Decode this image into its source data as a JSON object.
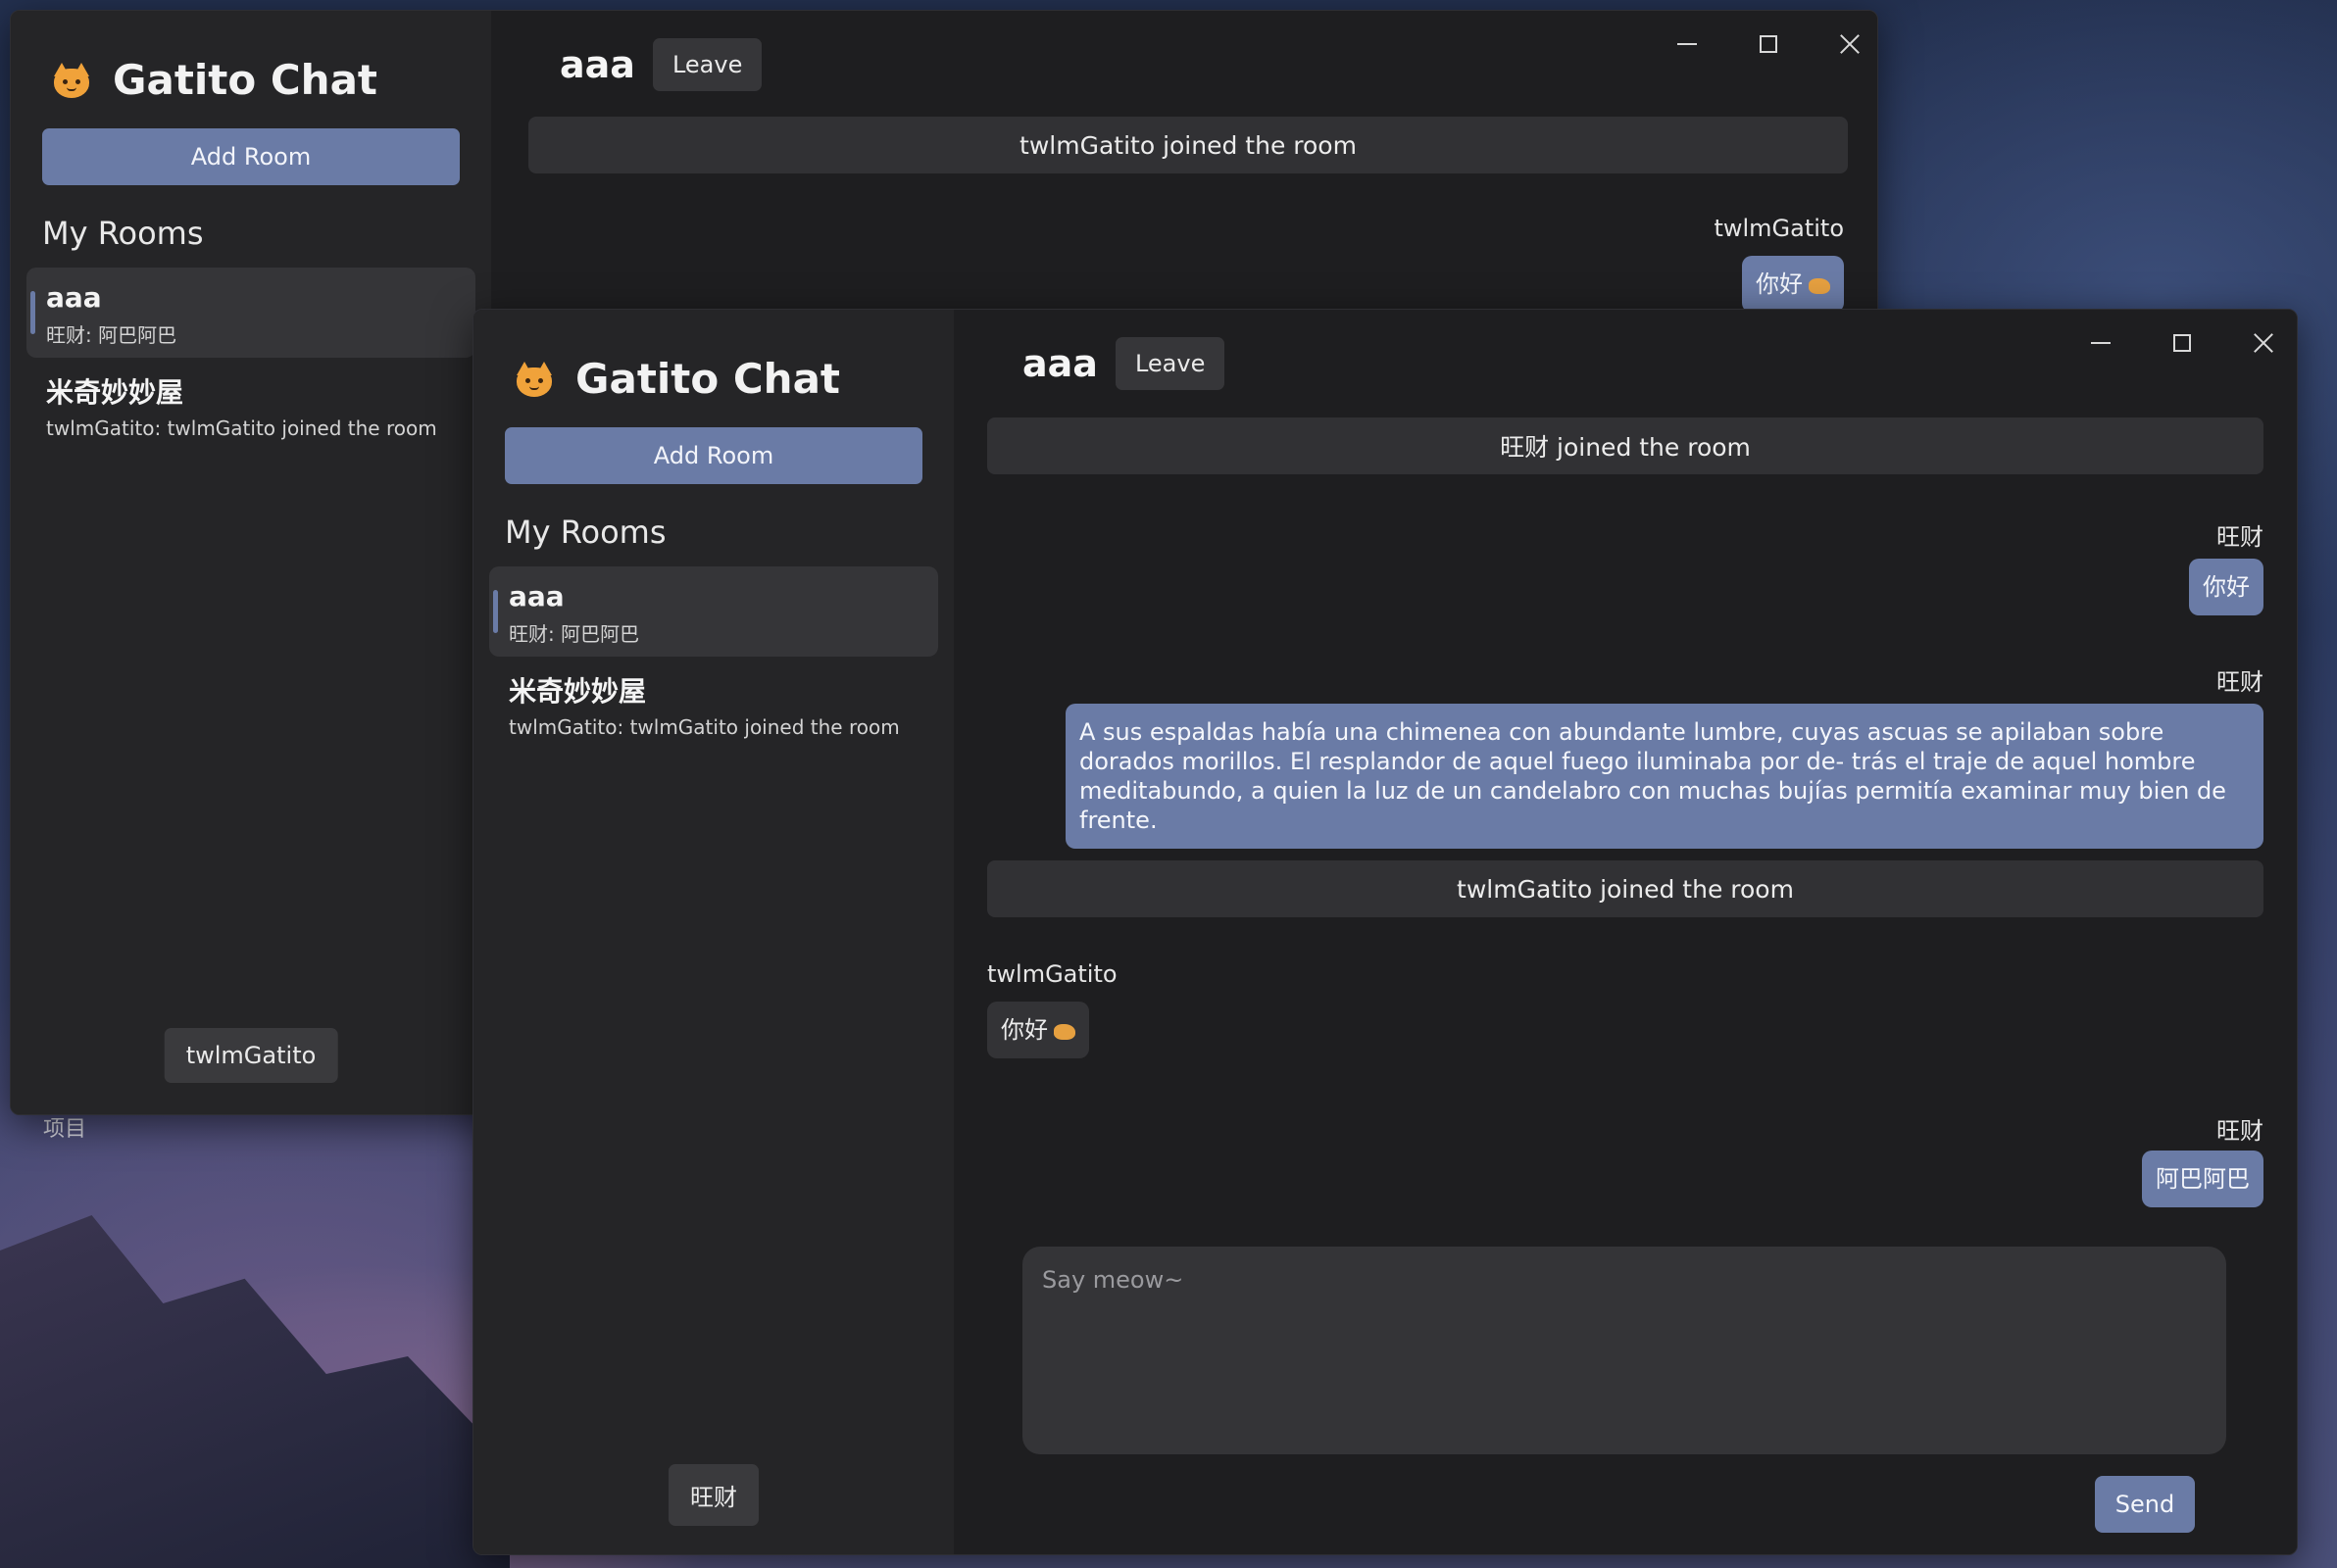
{
  "desktop": {
    "label": "项目"
  },
  "back_window": {
    "brand": "Gatito Chat",
    "add_room": "Add Room",
    "rooms_heading": "My Rooms",
    "rooms": [
      {
        "name": "aaa",
        "preview": "旺财: 阿巴阿巴"
      },
      {
        "name": "米奇妙妙屋",
        "preview": "twlmGatito: twlmGatito joined the room"
      }
    ],
    "username": "twlmGatito",
    "room_title": "aaa",
    "leave": "Leave",
    "messages": {
      "system": "twlmGatito joined the room",
      "sender": "twlmGatito",
      "bubble": "你好"
    }
  },
  "front_window": {
    "brand": "Gatito Chat",
    "add_room": "Add Room",
    "rooms_heading": "My Rooms",
    "rooms": [
      {
        "name": "aaa",
        "preview": "旺财: 阿巴阿巴"
      },
      {
        "name": "米奇妙妙屋",
        "preview": "twlmGatito: twlmGatito joined the room"
      }
    ],
    "username": "旺财",
    "room_title": "aaa",
    "leave": "Leave",
    "messages": [
      {
        "type": "system",
        "text": "旺财 joined the room"
      },
      {
        "type": "mine",
        "sender": "旺财",
        "text": "你好"
      },
      {
        "type": "mine",
        "sender": "旺财",
        "text": "A sus espaldas había una chimenea con abundante lumbre, cuyas ascuas se apilaban sobre dorados morillos. El resplandor de aquel fuego iluminaba por de- trás el traje de aquel hombre meditabundo, a quien la luz de un candelabro con muchas bujías permitía examinar muy bien de frente."
      },
      {
        "type": "system",
        "text": "twlmGatito joined the room"
      },
      {
        "type": "theirs",
        "sender": "twlmGatito",
        "text": "你好"
      },
      {
        "type": "mine",
        "sender": "旺财",
        "text": "阿巴阿巴"
      }
    ],
    "composer_placeholder": "Say meow~",
    "send": "Send"
  },
  "colors": {
    "accent": "#6a7ba6",
    "sidebar_bg": "#252527",
    "chat_bg": "#1e1e20",
    "system_msg_bg": "#313134",
    "theirs_bubble_bg": "#333336"
  },
  "icons": [
    "cat-logo-icon",
    "cat-emoji-icon",
    "minimize-icon",
    "maximize-icon",
    "close-icon"
  ]
}
